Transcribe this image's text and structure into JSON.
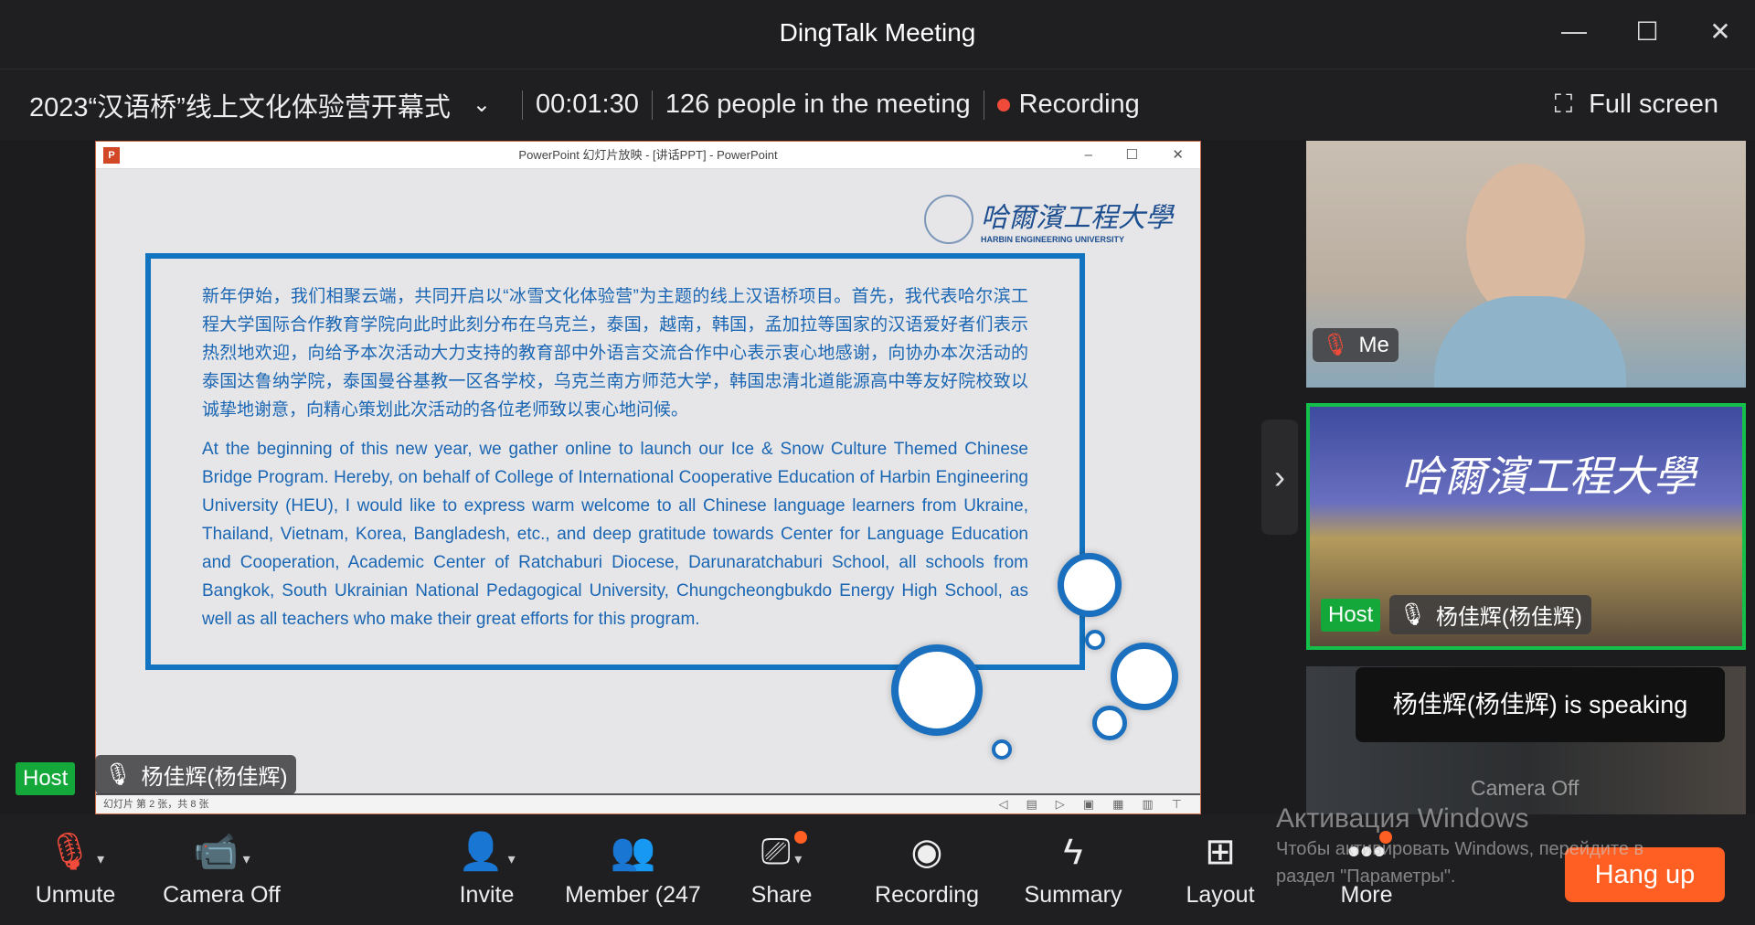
{
  "window": {
    "title": "DingTalk Meeting",
    "minimize": "—",
    "maximize": "☐",
    "close": "✕"
  },
  "info": {
    "meeting_name": "2023“汉语桥”线上文化体验营开幕式",
    "timer": "00:01:30",
    "people": "126 people in the meeting",
    "recording": "Recording",
    "fullscreen": "Full screen"
  },
  "ppt": {
    "title": "PowerPoint 幻灯片放映 - [讲话PPT] - PowerPoint",
    "logo_cn": "哈爾濱工程大學",
    "logo_en": "HARBIN ENGINEERING UNIVERSITY",
    "para_cn": "新年伊始，我们相聚云端，共同开启以“冰雪文化体验营”为主题的线上汉语桥项目。首先，我代表哈尔滨工程大学国际合作教育学院向此时此刻分布在乌克兰，泰国，越南，韩国，孟加拉等国家的汉语爱好者们表示热烈地欢迎，向给予本次活动大力支持的教育部中外语言交流合作中心表示衷心地感谢，向协办本次活动的泰国达鲁纳学院，泰国曼谷基教一区各学校，乌克兰南方师范大学，韩国忠清北道能源高中等友好院校致以诚挚地谢意，向精心策划此次活动的各位老师致以衷心地问候。",
    "para_en": "At the beginning of this new year, we gather online to launch our Ice & Snow Culture Themed Chinese Bridge Program. Hereby, on behalf of College of International Cooperative Education of Harbin Engineering University (HEU), I would like to express warm welcome to all Chinese language learners from Ukraine, Thailand, Vietnam, Korea, Bangladesh, etc., and deep gratitude towards Center for Language Education and Cooperation, Academic Center of Ratchaburi Diocese, Darunaratchaburi School, all schools from Bangkok, South Ukrainian National Pedagogical University, Chungcheongbukdo Energy High School, as well as all teachers who make their great efforts for this program.",
    "status": "幻灯片 第 2 张，共 8 张"
  },
  "main_speaker": {
    "host": "Host",
    "name": "杨佳辉(杨佳辉)"
  },
  "side": {
    "me": "Me",
    "host": "Host",
    "host_name": "杨佳辉(杨佳辉)",
    "speaking": "杨佳辉(杨佳辉)  is speaking",
    "camera_off": "Camera Off"
  },
  "toolbar": {
    "unmute": "Unmute",
    "camera": "Camera Off",
    "invite": "Invite",
    "member": "Member (247",
    "share": "Share",
    "recording": "Recording",
    "summary": "Summary",
    "layout": "Layout",
    "more": "More",
    "hangup": "Hang up"
  },
  "watermark": {
    "title": "Активация Windows",
    "line1": "Чтобы активировать Windows, перейдите в",
    "line2": "раздел \"Параметры\"."
  },
  "colors": {
    "host_green": "#14a83b",
    "hangup": "#ff5f22",
    "record_dot": "#f04a3a",
    "slide_blue": "#1273c0"
  }
}
